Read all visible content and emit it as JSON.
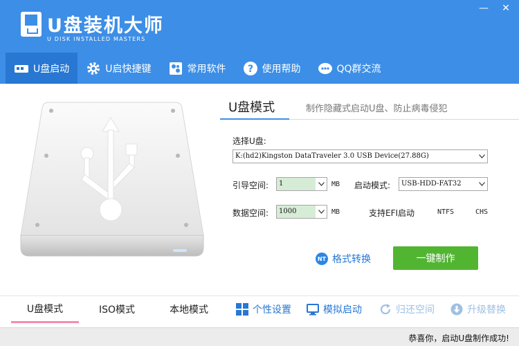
{
  "app": {
    "title": "U盘装机大师",
    "subtitle": "U DISK INSTALLED MASTERS"
  },
  "window_controls": {
    "minimize": "—",
    "close": "✕"
  },
  "nav": {
    "items": [
      {
        "label": "U盘启动",
        "icon": "usb-drive-icon",
        "active": true
      },
      {
        "label": "U启快捷键",
        "icon": "gear-icon",
        "active": false
      },
      {
        "label": "常用软件",
        "icon": "software-icon",
        "active": false
      },
      {
        "label": "使用帮助",
        "icon": "help-icon",
        "active": false
      },
      {
        "label": "QQ群交流",
        "icon": "qq-icon",
        "active": false
      }
    ]
  },
  "mode": {
    "title": "U盘模式",
    "description": "制作隐藏式启动U盘、防止病毒侵犯"
  },
  "form": {
    "select_disk_label": "选择U盘:",
    "disk_value": "K:(hd2)Kingston DataTraveler 3.0 USB Device(27.88G)",
    "boot_space_label": "引导空间:",
    "boot_space_value": "1",
    "boot_space_unit": "MB",
    "boot_mode_label": "启动模式:",
    "boot_mode_value": "USB-HDD-FAT32",
    "data_space_label": "数据空间:",
    "data_space_value": "1000",
    "data_space_unit": "MB",
    "efi_label": "支持EFI启动",
    "ntfs_label": "NTFS",
    "chs_label": "CHS"
  },
  "actions": {
    "format_convert": "格式转换",
    "nt_badge": "NT",
    "one_click": "一键制作"
  },
  "bottom_tabs": [
    {
      "label": "U盘模式",
      "active": true
    },
    {
      "label": "ISO模式",
      "active": false
    },
    {
      "label": "本地模式",
      "active": false
    }
  ],
  "bottom_tools": [
    {
      "label": "个性设置",
      "icon": "grid-icon",
      "enabled": true
    },
    {
      "label": "模拟启动",
      "icon": "monitor-icon",
      "enabled": true
    },
    {
      "label": "归还空间",
      "icon": "refresh-icon",
      "enabled": false
    },
    {
      "label": "升级替换",
      "icon": "download-icon",
      "enabled": false
    }
  ],
  "status": {
    "message": "恭喜你，启动U盘制作成功!"
  },
  "colors": {
    "header": "#3d8ee6",
    "nav_active": "#2777d3",
    "primary_button": "#52b532",
    "tab_indicator": "#f78ab0"
  }
}
